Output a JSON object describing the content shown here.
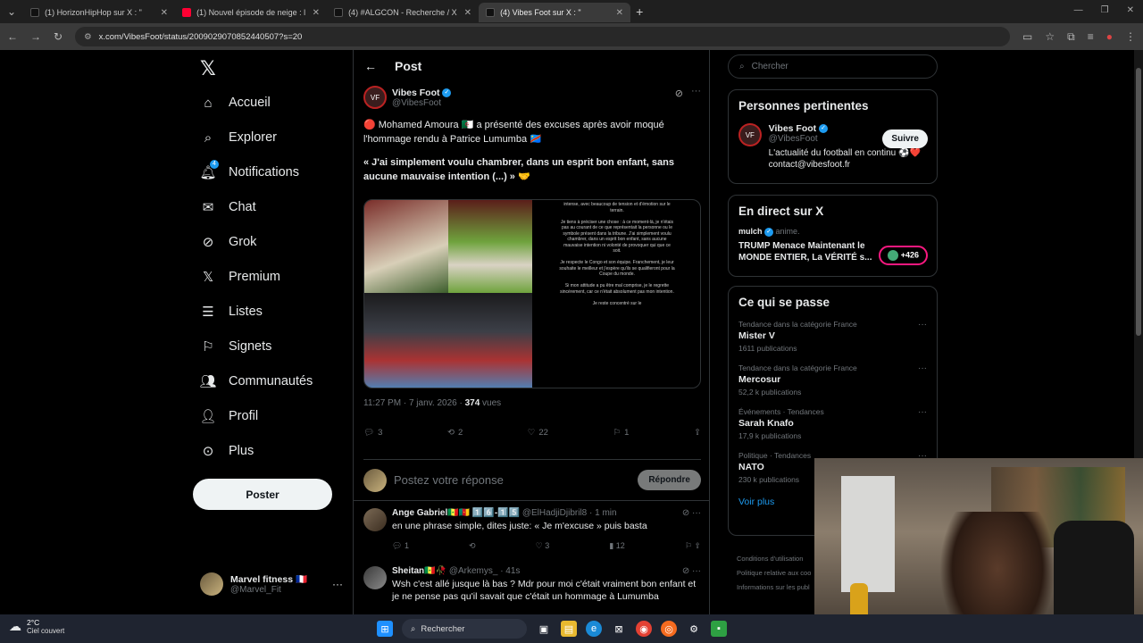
{
  "browser": {
    "tabs": [
      {
        "title": "(1) HorizonHipHop sur X : \"",
        "fav_color": "#111"
      },
      {
        "title": "(1) Nouvel épisode de neige : l",
        "fav_color": "#ff0033"
      },
      {
        "title": "(4) #ALGCON - Recherche / X",
        "fav_color": "#111"
      },
      {
        "title": "(4) Vibes Foot sur X : \"",
        "fav_color": "#111"
      }
    ],
    "url": "x.com/VibesFoot/status/2009029070852440507?s=20"
  },
  "nav": {
    "items": [
      {
        "label": "Accueil",
        "icon": "home-icon"
      },
      {
        "label": "Explorer",
        "icon": "search-icon"
      },
      {
        "label": "Notifications",
        "icon": "bell-icon",
        "badge": "4"
      },
      {
        "label": "Chat",
        "icon": "mail-icon"
      },
      {
        "label": "Grok",
        "icon": "grok-icon"
      },
      {
        "label": "Premium",
        "icon": "x-icon"
      },
      {
        "label": "Listes",
        "icon": "list-icon"
      },
      {
        "label": "Signets",
        "icon": "bookmark-icon"
      },
      {
        "label": "Communautés",
        "icon": "people-icon"
      },
      {
        "label": "Profil",
        "icon": "person-icon"
      },
      {
        "label": "Plus",
        "icon": "more-icon"
      }
    ],
    "post_button": "Poster",
    "account": {
      "name": "Marvel fitness 🇫🇷",
      "handle": "@Marvel_Fit"
    }
  },
  "main": {
    "title": "Post",
    "tweet": {
      "name": "Vibes Foot",
      "handle": "@VibesFoot",
      "text1": "🔴 Mohamed Amoura 🇩🇿 a présenté des excuses après avoir moqué l'hommage rendu à Patrice Lumumba 🇨🇩",
      "quote_open": "« J'ai simplement ",
      "quote_bold": "voulu chambrer, dans un esprit bon enfant, sans aucune mauvaise intention (...) »",
      "quote_end": " 🤝",
      "media_text": "intense, avec beaucoup de tension et d'émotion sur le terrain.\n\nJe tiens à préciser une chose : à ce moment-là, je n'étais pas au courant de ce que représentait la personne ou le symbole présent dans la tribune. J'ai simplement voulu chambrer, dans un esprit bon enfant, sans aucune mauvaise intention ni volonté de provoquer qui que ce soit.\n\nJe respecte le Congo et son équipe. Franchement, je leur souhaite le meilleur et j'espère qu'ils se qualifieront pour la Coupe du monde.\n\nSi mon attitude a pu être mal comprise, je le regrette sincèrement, car ce n'était absolument pas mon intention.\n\nJe reste concentré sur le",
      "time": "11:27 PM · 7 janv. 2026 · ",
      "views": "374",
      "views_label": " vues",
      "replies": "3",
      "retweets": "2",
      "likes": "22",
      "bookmarks": "1"
    },
    "reply_placeholder": "Postez votre réponse",
    "reply_button": "Répondre",
    "comments": [
      {
        "name": "Ange Gabriel🇸🇳🇨🇲 1️⃣6️⃣-1️⃣5️⃣",
        "handle": "@ElHadjiDjibril8 · 1 min",
        "text": "en une phrase simple, dites juste: « Je m'excuse » puis basta",
        "replies": "1",
        "likes": "3",
        "views": "12"
      },
      {
        "name": "Sheitan🇸🇳🥀",
        "handle": "@Arkemys_ · 41s",
        "text": "Wsh c'est allé jusque là bas ? Mdr pour moi c'était vraiment bon enfant et je ne pense pas qu'il savait que c'était un hommage à Lumumba"
      }
    ]
  },
  "right": {
    "search_placeholder": "Chercher",
    "relevant": {
      "title": "Personnes pertinentes",
      "name": "Vibes Foot",
      "handle": "@VibesFoot",
      "bio": "L'actualité du football en continu ⚽❤️ contact@vibesfoot.fr",
      "follow": "Suivre"
    },
    "live": {
      "title": "En direct sur X",
      "host": "mulch",
      "host_meta": "anime.",
      "headline": "TRUMP Menace Maintenant le MONDE ENTIER, La VÉRITÉ s...",
      "count": "+426"
    },
    "happening": {
      "title": "Ce qui se passe",
      "trends": [
        {
          "cat": "Tendance dans la catégorie France",
          "name": "Mister V",
          "count": "1611 publications"
        },
        {
          "cat": "Tendance dans la catégorie France",
          "name": "Mercosur",
          "count": "52,2 k publications"
        },
        {
          "cat": "Événements · Tendances",
          "name": "Sarah Knafo",
          "count": "17,9 k publications"
        },
        {
          "cat": "Politique · Tendances",
          "name": "NATO",
          "count": "230 k publications"
        }
      ],
      "see_more": "Voir plus"
    },
    "footer": [
      "Conditions d'utilisation",
      "Politique relative aux coo",
      "Informations sur les publ"
    ]
  },
  "taskbar": {
    "temp": "2°C",
    "weather": "Ciel couvert",
    "search": "Rechercher"
  }
}
